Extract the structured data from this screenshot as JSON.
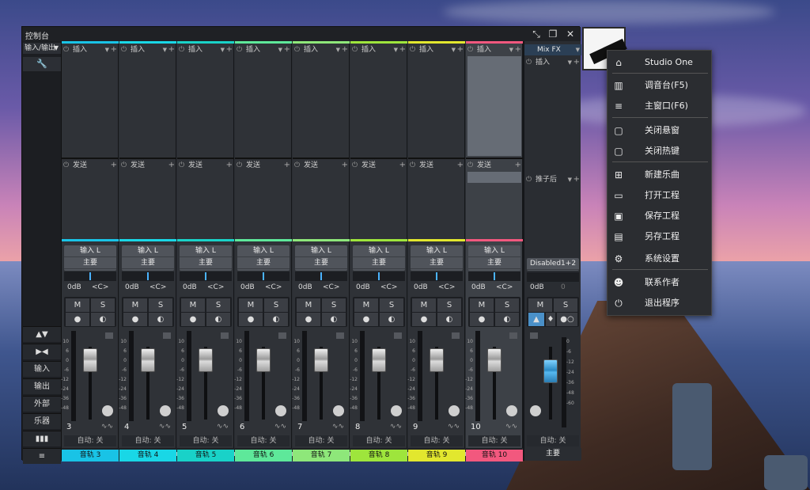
{
  "window": {
    "title": "控制台",
    "io_select": "输入/输出",
    "left_buttons": [
      "输入",
      "输出",
      "外部",
      "乐器"
    ]
  },
  "strips": [
    {
      "num": "3",
      "name": "音轨 3",
      "color": "#19c3e6"
    },
    {
      "num": "4",
      "name": "音轨 4",
      "color": "#19d7e6"
    },
    {
      "num": "5",
      "name": "音轨 5",
      "color": "#19d2c8"
    },
    {
      "num": "6",
      "name": "音轨 6",
      "color": "#5ee89a"
    },
    {
      "num": "7",
      "name": "音轨 7",
      "color": "#8ee77a"
    },
    {
      "num": "8",
      "name": "音轨 8",
      "color": "#9ee53c"
    },
    {
      "num": "9",
      "name": "音轨 9",
      "color": "#e2e72e"
    },
    {
      "num": "10",
      "name": "音轨 10",
      "color": "#f2587e"
    }
  ],
  "strip_labels": {
    "insert": "插入",
    "send": "发送",
    "input": "输入 L",
    "main": "主要",
    "gain": "0dB",
    "pan": "<C>",
    "mute": "M",
    "solo": "S",
    "auto": "自动: 关",
    "scale": [
      "10",
      "6",
      "0",
      "-6",
      "-12",
      "-24",
      "-36",
      "-48"
    ]
  },
  "mix": {
    "header": "Mix FX",
    "insert": "插入",
    "post": "推子后",
    "output": "Disabled1+2",
    "gain": "0dB",
    "pan": "0",
    "mute": "M",
    "solo": "S",
    "auto": "自动: 关",
    "name": "主要",
    "scale": [
      "0",
      "-6",
      "-12",
      "-24",
      "-36",
      "-48",
      "-60"
    ]
  },
  "menu": {
    "items": [
      {
        "label": "Studio One",
        "icon": "home-icon"
      },
      {
        "label": "调音台(F5)",
        "icon": "mixer-icon"
      },
      {
        "label": "主窗口(F6)",
        "icon": "menu-lines-icon"
      },
      {
        "label": "关闭悬窗",
        "icon": "window-close-icon"
      },
      {
        "label": "关闭热键",
        "icon": "window-close-icon"
      },
      {
        "label": "新建乐曲",
        "icon": "new-project-icon"
      },
      {
        "label": "打开工程",
        "icon": "folder-icon"
      },
      {
        "label": "保存工程",
        "icon": "save-icon"
      },
      {
        "label": "另存工程",
        "icon": "save-as-icon"
      },
      {
        "label": "系统设置",
        "icon": "gear-icon"
      },
      {
        "label": "联系作者",
        "icon": "contact-icon"
      },
      {
        "label": "退出程序",
        "icon": "power-icon"
      }
    ]
  }
}
